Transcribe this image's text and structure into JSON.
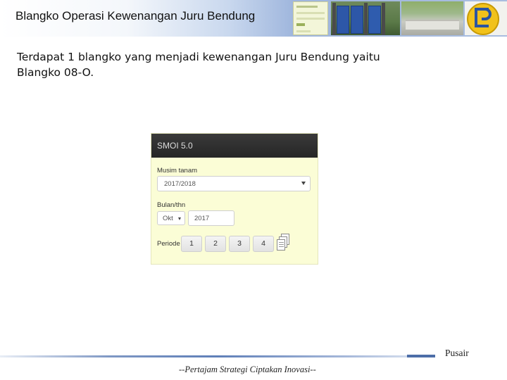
{
  "slide": {
    "title": "Blangko Operasi Kewenangan Juru Bendung",
    "body": "Terdapat 1 blangko yang menjadi kewenangan Juru Bendung yaitu Blangko 08-O."
  },
  "app": {
    "title": "SMOI 5.0",
    "musim_label": "Musim tanam",
    "musim_value": "2017/2018",
    "bulan_label": "Bulan/thn",
    "month_value": "Okt",
    "year_value": "2017",
    "periode_label": "Periode",
    "periods": [
      "1",
      "2",
      "3",
      "4"
    ]
  },
  "footer": {
    "brand": "Pusair",
    "tagline": "--Pertajam Strategi Ciptakan Inovasi--"
  },
  "icons": [
    "chevron-down-icon",
    "documents-icon",
    "pu-logo-icon"
  ],
  "colors": {
    "app_background": "#fbfdd6",
    "app_header": "#2b2b2b",
    "logo_yellow": "#f1c21b",
    "logo_blue": "#2a55a2"
  }
}
